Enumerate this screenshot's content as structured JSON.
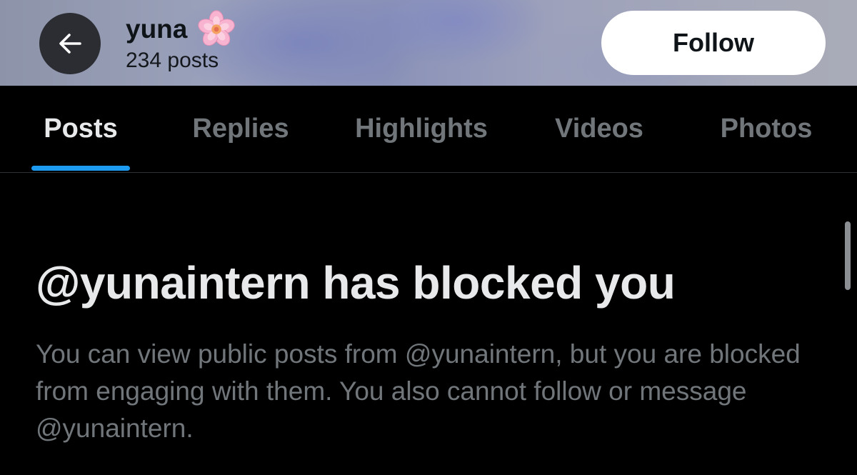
{
  "header": {
    "back_icon": "arrow-left-icon",
    "name": "yuna",
    "name_emoji_icon": "cherry-blossom-icon",
    "posts_count": "234 posts",
    "follow_label": "Follow"
  },
  "tabs": [
    {
      "label": "Posts",
      "active": true
    },
    {
      "label": "Replies",
      "active": false
    },
    {
      "label": "Highlights",
      "active": false
    },
    {
      "label": "Videos",
      "active": false
    },
    {
      "label": "Photos",
      "active": false
    }
  ],
  "blocked": {
    "title": "@yunaintern has blocked you",
    "description": "You can view public posts from @yunaintern, but you are blocked from engaging with them. You also cannot follow or message @yunaintern."
  },
  "colors": {
    "background": "#000000",
    "accent": "#1d9bf0",
    "text_primary": "#e7e9ea",
    "text_secondary": "#71767b",
    "follow_button_bg": "#ffffff"
  }
}
